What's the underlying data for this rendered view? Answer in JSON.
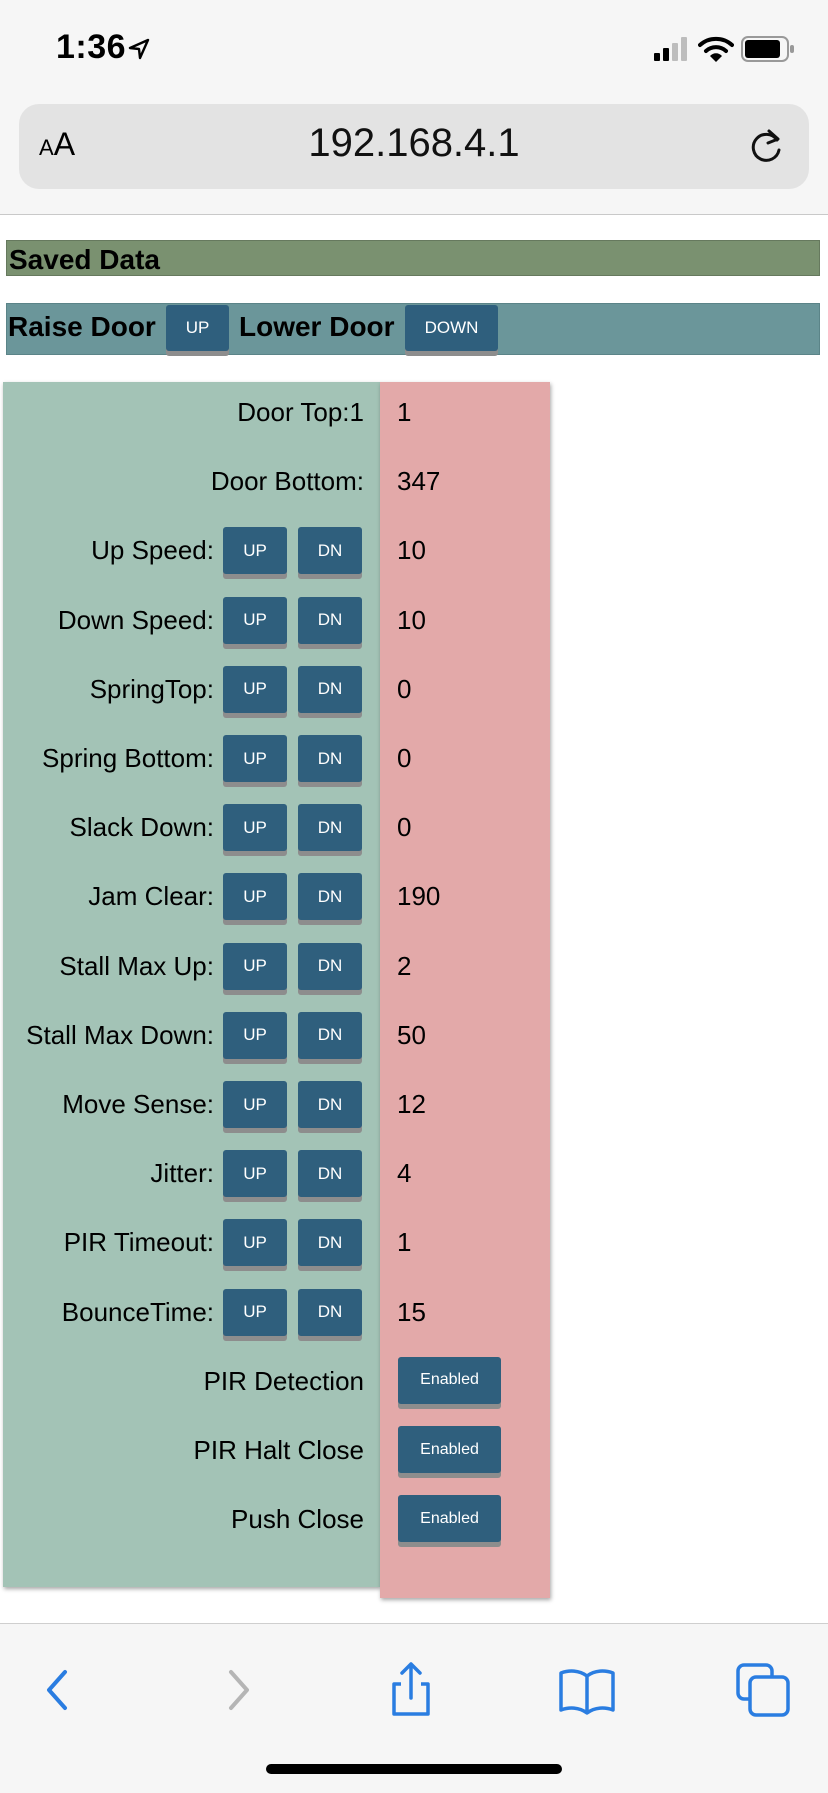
{
  "status_bar": {
    "time": "1:36"
  },
  "browser": {
    "aa_small": "A",
    "aa_large": "A",
    "url": "192.168.4.1"
  },
  "page": {
    "saved_header": "Saved Data",
    "raise_label": "Raise Door",
    "raise_button": "UP",
    "lower_label": "Lower Door",
    "lower_button": "DOWN",
    "up_label": "UP",
    "dn_label": "DN",
    "rows": [
      {
        "label": "Door Top:1",
        "value": "1"
      },
      {
        "label": "Door Bottom:",
        "value": "347"
      },
      {
        "label": "Up Speed:",
        "value": "10"
      },
      {
        "label": "Down Speed:",
        "value": "10"
      },
      {
        "label": "SpringTop:",
        "value": "0"
      },
      {
        "label": "Spring Bottom:",
        "value": "0"
      },
      {
        "label": "Slack Down:",
        "value": "0"
      },
      {
        "label": "Jam Clear:",
        "value": "190"
      },
      {
        "label": "Stall Max Up:",
        "value": "2"
      },
      {
        "label": "Stall Max Down:",
        "value": "50"
      },
      {
        "label": "Move Sense:",
        "value": "12"
      },
      {
        "label": "Jitter:",
        "value": "4"
      },
      {
        "label": "PIR Timeout:",
        "value": "1"
      },
      {
        "label": "BounceTime:",
        "value": "15"
      }
    ],
    "toggles": [
      {
        "label": "PIR Detection",
        "value": "Enabled"
      },
      {
        "label": "PIR Halt Close",
        "value": "Enabled"
      },
      {
        "label": "Push Close",
        "value": "Enabled"
      }
    ]
  },
  "colors": {
    "accent_blue": "#2f5f7d",
    "saved_header_bg": "#7a9170",
    "door_bar_bg": "#6b969a",
    "settings_bg": "#a3c3b6",
    "values_bg": "#e3a9a9",
    "ios_blue": "#2a7de1"
  },
  "icons": [
    "location-arrow-icon",
    "signal-icon",
    "wifi-icon",
    "battery-icon",
    "reload-icon",
    "back-icon",
    "forward-icon",
    "share-icon",
    "bookmarks-icon",
    "tabs-icon"
  ]
}
